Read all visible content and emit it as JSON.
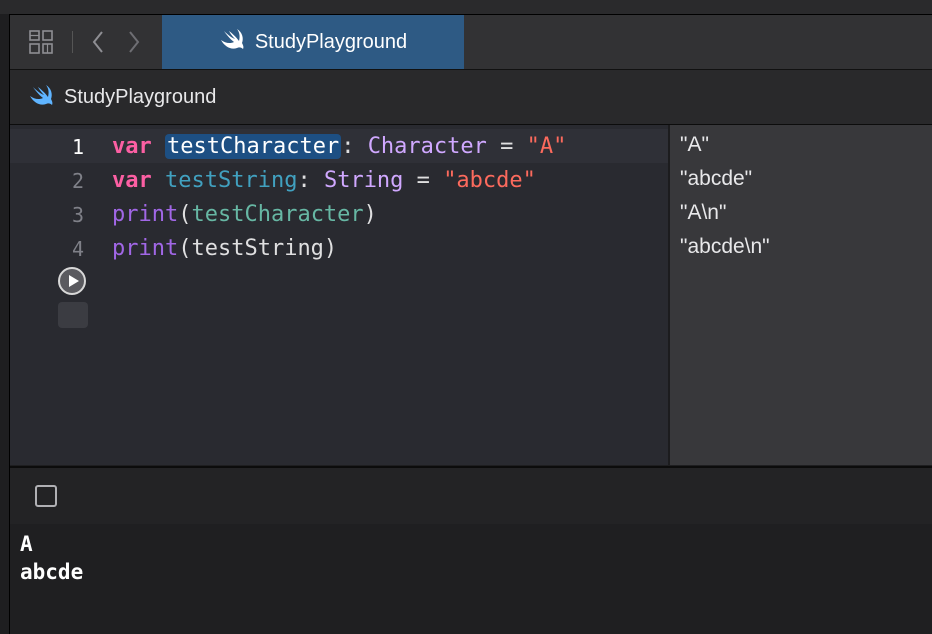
{
  "toolbar": {
    "grid_icon": "grid-icon",
    "back_icon": "chevron-left-icon",
    "forward_icon": "chevron-right-icon"
  },
  "tab": {
    "label": "StudyPlayground",
    "icon": "swift-icon"
  },
  "jumpbar": {
    "title": "StudyPlayground",
    "icon": "swift-icon"
  },
  "editor": {
    "lines": [
      {
        "number": "1",
        "tokens": [
          {
            "text": "var",
            "cls": "kw"
          },
          {
            "text": " ",
            "cls": ""
          },
          {
            "text": "testCharacter",
            "cls": "sel"
          },
          {
            "text": ": ",
            "cls": ""
          },
          {
            "text": "Character",
            "cls": "type"
          },
          {
            "text": " = ",
            "cls": ""
          },
          {
            "text": "\"A\"",
            "cls": "str"
          }
        ]
      },
      {
        "number": "2",
        "tokens": [
          {
            "text": "var",
            "cls": "kw"
          },
          {
            "text": " ",
            "cls": ""
          },
          {
            "text": "testString",
            "cls": "decl2"
          },
          {
            "text": ": ",
            "cls": ""
          },
          {
            "text": "String",
            "cls": "type"
          },
          {
            "text": " = ",
            "cls": ""
          },
          {
            "text": "\"abcde\"",
            "cls": "str"
          }
        ]
      },
      {
        "number": "3",
        "tokens": [
          {
            "text": "print",
            "cls": "fn"
          },
          {
            "text": "(",
            "cls": ""
          },
          {
            "text": "testCharacter",
            "cls": "ref"
          },
          {
            "text": ")",
            "cls": ""
          }
        ]
      },
      {
        "number": "4",
        "tokens": [
          {
            "text": "print",
            "cls": "fn"
          },
          {
            "text": "(testString)",
            "cls": ""
          }
        ]
      }
    ],
    "run_icon": "play-icon"
  },
  "results": [
    "\"A\"",
    "\"abcde\"",
    "\"A\\n\"",
    "\"abcde\\n\""
  ],
  "console": {
    "toggle_icon": "square-icon",
    "output": [
      "A",
      "abcde"
    ]
  },
  "colors": {
    "accent_tab": "#2e5a84",
    "selection": "#1d4f83",
    "keyword": "#fc5fa3",
    "string": "#fc6a5d",
    "type": "#d0a8ff"
  }
}
